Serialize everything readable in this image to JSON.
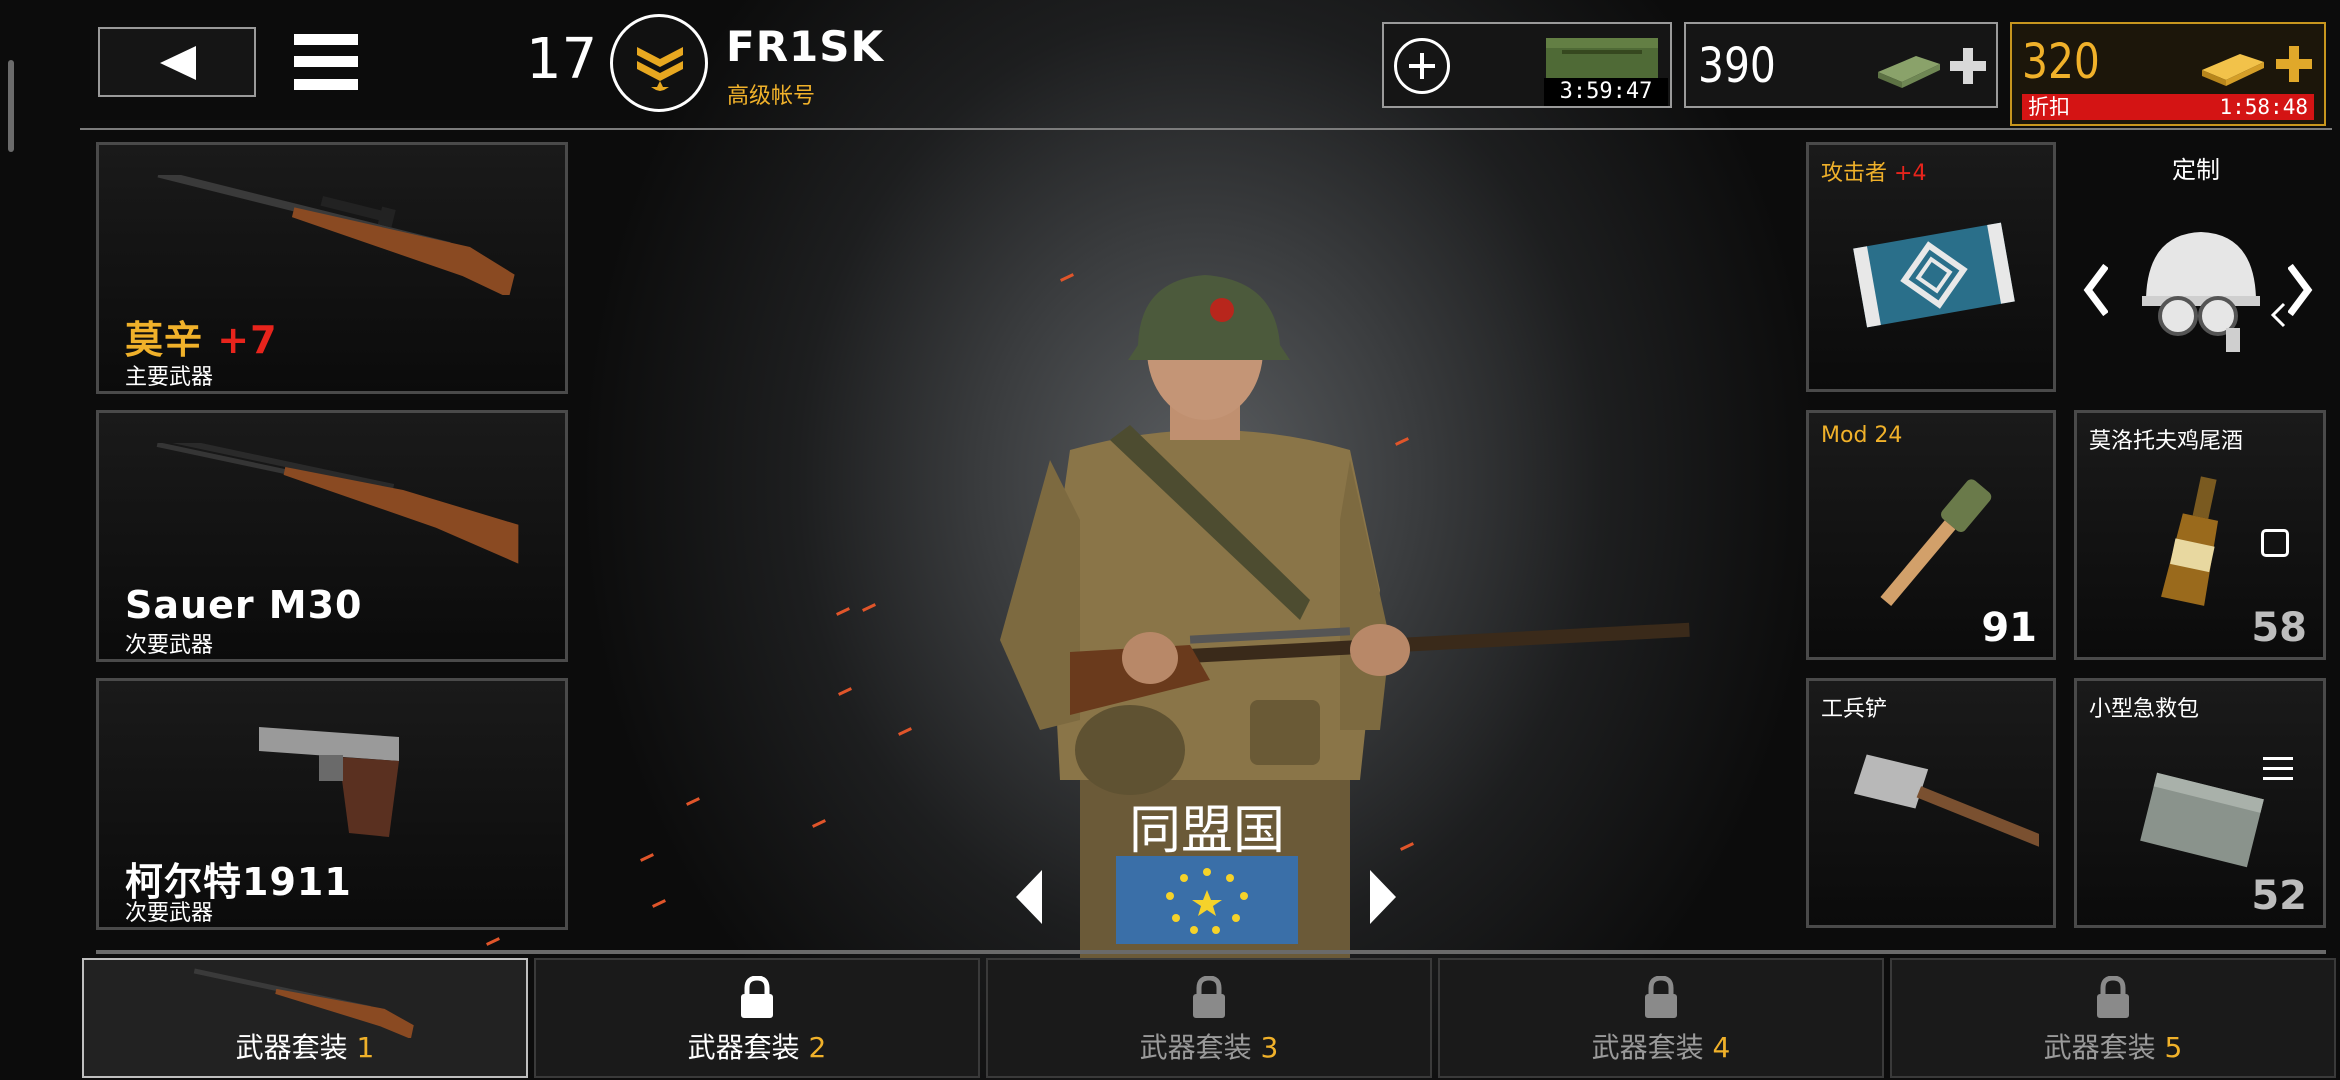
{
  "header": {
    "level": "17",
    "player_name": "FR1SK",
    "account_type": "高级帐号",
    "crate_timer": "3:59:47",
    "cash_amount": "390",
    "gold_amount": "320",
    "discount_label": "折扣",
    "discount_timer": "1:58:48"
  },
  "weapons": [
    {
      "name": "莫辛",
      "bonus": "+7",
      "type": "主要武器"
    },
    {
      "name": "Sauer M30",
      "bonus": "",
      "type": "次要武器"
    },
    {
      "name": "柯尔特1911",
      "bonus": "",
      "type": "次要武器"
    }
  ],
  "faction": {
    "name": "同盟国"
  },
  "gear": {
    "attacker": {
      "title": "攻击者",
      "bonus": "+4"
    },
    "customize_label": "定制",
    "grenade": {
      "title": "Mod 24",
      "count": "91"
    },
    "molotov": {
      "title": "莫洛托夫鸡尾酒",
      "count": "58"
    },
    "shovel": {
      "title": "工兵铲"
    },
    "medkit": {
      "title": "小型急救包",
      "count": "52"
    }
  },
  "loadouts": [
    {
      "label": "武器套装",
      "num": "1",
      "locked": false
    },
    {
      "label": "武器套装",
      "num": "2",
      "locked": true
    },
    {
      "label": "武器套装",
      "num": "3",
      "locked": true
    },
    {
      "label": "武器套装",
      "num": "4",
      "locked": true
    },
    {
      "label": "武器套装",
      "num": "5",
      "locked": true
    }
  ],
  "colors": {
    "accent_gold": "#f0b12a",
    "bonus_red": "#e8241c",
    "discount_red": "#d41414",
    "flag_blue": "#3a6fa8"
  },
  "icons": [
    "back-arrow-icon",
    "menu-icon",
    "sergeant-rank-icon",
    "add-circle-icon",
    "supply-crate-icon",
    "cash-stack-icon",
    "plus-icon",
    "gold-bar-icon",
    "lock-icon",
    "eu-flag-icon",
    "chevron-left-icon",
    "chevron-right-icon",
    "square-icon",
    "list-icon"
  ]
}
